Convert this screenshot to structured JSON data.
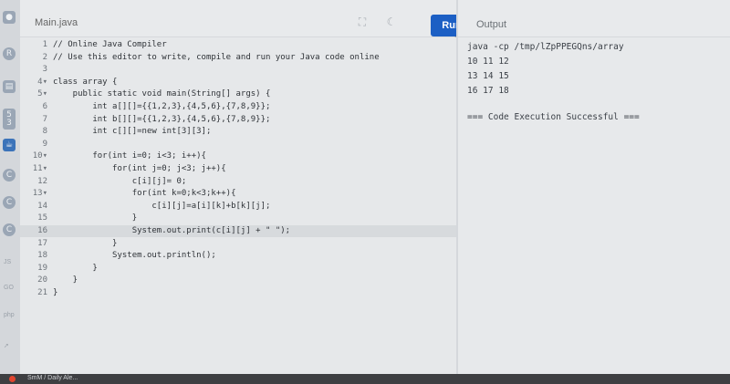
{
  "editor": {
    "file_tab": "Main.java",
    "run_label": "Run",
    "lines": [
      {
        "n": "1",
        "code": "// Online Java Compiler"
      },
      {
        "n": "2",
        "code": "// Use this editor to write, compile and run your Java code online"
      },
      {
        "n": "3",
        "code": ""
      },
      {
        "n": "4▾",
        "code": "class array {"
      },
      {
        "n": "5▾",
        "code": "    public static void main(String[] args) {"
      },
      {
        "n": "6",
        "code": "        int a[][]={{1,2,3},{4,5,6},{7,8,9}};"
      },
      {
        "n": "7",
        "code": "        int b[][]={{1,2,3},{4,5,6},{7,8,9}};"
      },
      {
        "n": "8",
        "code": "        int c[][]=new int[3][3];"
      },
      {
        "n": "9",
        "code": ""
      },
      {
        "n": "10▾",
        "code": "        for(int i=0; i<3; i++){"
      },
      {
        "n": "11▾",
        "code": "            for(int j=0; j<3; j++){"
      },
      {
        "n": "12",
        "code": "                c[i][j]= 0;"
      },
      {
        "n": "13▾",
        "code": "                for(int k=0;k<3;k++){"
      },
      {
        "n": "14",
        "code": "                    c[i][j]=a[i][k]+b[k][j];"
      },
      {
        "n": "15",
        "code": "                }"
      },
      {
        "n": "16",
        "code": "                System.out.print(c[i][j] + \" \");"
      },
      {
        "n": "17",
        "code": "            }"
      },
      {
        "n": "18",
        "code": "            System.out.println();"
      },
      {
        "n": "19",
        "code": "        }"
      },
      {
        "n": "20",
        "code": "    }"
      },
      {
        "n": "21",
        "code": "}"
      }
    ],
    "highlighted_line": "16"
  },
  "output": {
    "title": "Output",
    "lines": [
      "java -cp /tmp/lZpPPEGQns/array",
      "10 11 12",
      "13 14 15",
      "16 17 18",
      "",
      "=== Code Execution Successful ==="
    ]
  },
  "sidebar": {
    "icons": [
      "java-icon",
      "python-icon",
      "html-icon",
      "css-icon",
      "code-icon",
      "c-icon",
      "cpp-icon",
      "csharp-icon"
    ],
    "labels": [
      "JS",
      "GO",
      "php"
    ]
  },
  "taskbar": {
    "text": "SmM / Daily Ale..."
  },
  "colors": {
    "run_button": "#1c5fc4",
    "background": "#e4e6e8"
  }
}
